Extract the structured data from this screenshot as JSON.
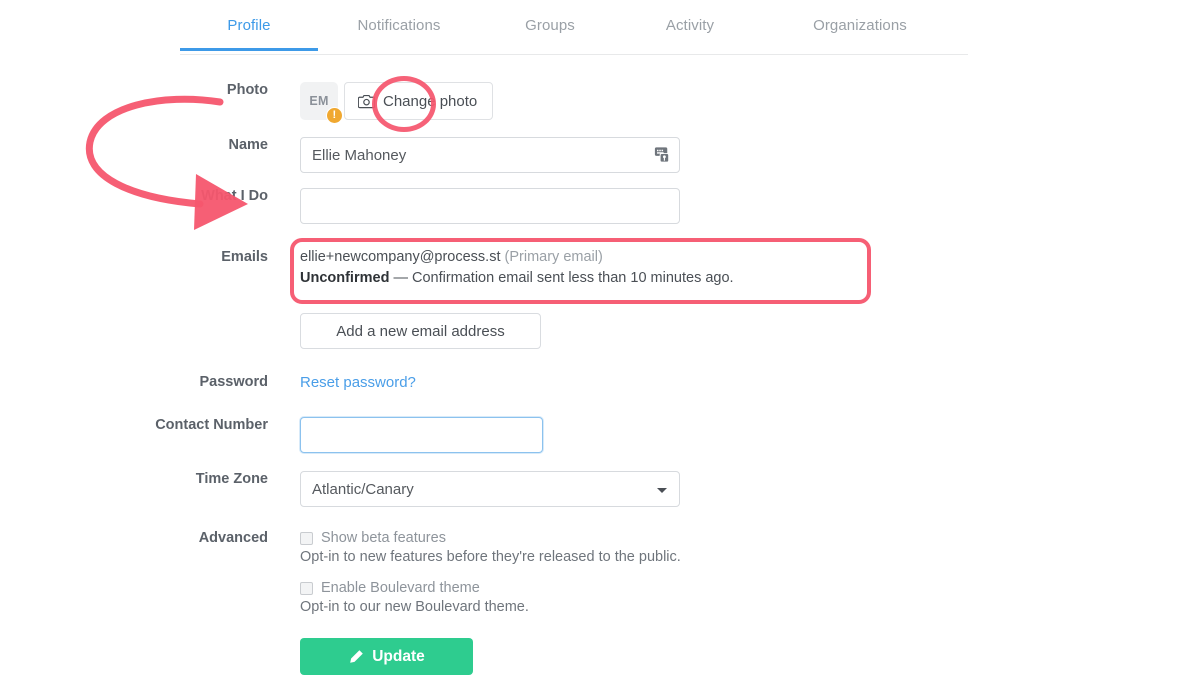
{
  "tabs": [
    {
      "label": "Profile",
      "active": true
    },
    {
      "label": "Notifications",
      "active": false
    },
    {
      "label": "Groups",
      "active": false
    },
    {
      "label": "Activity",
      "active": false
    },
    {
      "label": "Organizations",
      "active": false
    }
  ],
  "accent_colors": {
    "tab_active": "#3d9ae8",
    "link": "#4a9ee8",
    "primary_button": "#2ecc8f",
    "annotation": "#f5566e",
    "avatar_badge": "#f0a830"
  },
  "form": {
    "photo": {
      "label": "Photo",
      "avatar_initials": "EM",
      "avatar_badge": "!",
      "change_photo_label": "Change photo",
      "camera_icon": "camera-icon"
    },
    "name": {
      "label": "Name",
      "value": "Ellie Mahoney",
      "placeholder": "",
      "autofill_icon": "autofill-icon"
    },
    "what_i_do": {
      "label": "What I Do",
      "value": "",
      "placeholder": ""
    },
    "emails": {
      "label": "Emails",
      "address": "ellie+newcompany@process.st",
      "primary_tag": "(Primary email)",
      "status": "Unconfirmed",
      "status_separator": "—",
      "status_detail": "Confirmation email sent less than 10 minutes ago.",
      "add_email_label": "Add a new email address"
    },
    "password": {
      "label": "Password",
      "reset_link": "Reset password?"
    },
    "contact_number": {
      "label": "Contact Number",
      "value": "",
      "placeholder": ""
    },
    "time_zone": {
      "label": "Time Zone",
      "value": "Atlantic/Canary",
      "caret_icon": "chevron-down-icon"
    },
    "advanced": {
      "label": "Advanced",
      "options": [
        {
          "label": "Show beta features",
          "help": "Opt-in to new features before they're released to the public.",
          "checked": false
        },
        {
          "label": "Enable Boulevard theme",
          "help": "Opt-in to our new Boulevard theme.",
          "checked": false
        }
      ]
    },
    "update_button": {
      "label": "Update",
      "icon": "pencil-icon"
    }
  },
  "annotations": {
    "arrow": "curved-arrow-pointing-right",
    "ellipse_target": "avatar",
    "box_target": "emails-row"
  }
}
